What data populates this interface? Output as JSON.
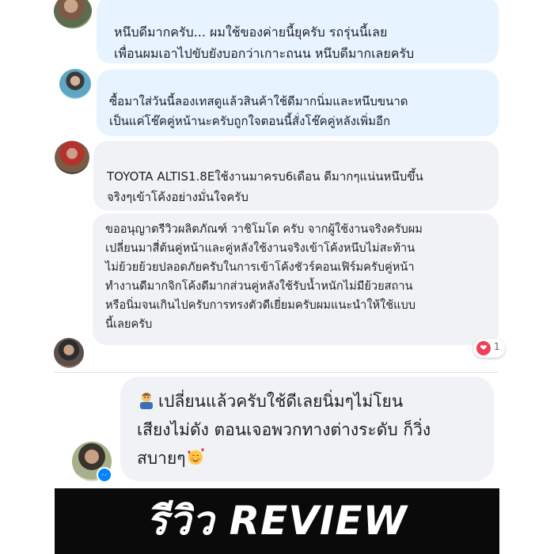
{
  "comments": [
    {
      "lines": [
        "หนึบดีมากครับ... ผมใช้ของค่ายนี้ยุครับ รถรุ่นนี้เลย",
        "เพื่อนผมเอาไปขับยังบอกว่าเกาะถนน หนึบดีมากเลยครับ"
      ]
    },
    {
      "lines": [
        "ซื้อมาใส่วันนี้ลองเทสดูแล้วสินค้าใช้ดีมากนิ่มและหนึบขนาด",
        "เป็นแค่โช๊คคู่หน้านะครับถูกใจตอนนี้สั่งโช๊คคู่หลังเพิ่มอีก"
      ]
    },
    {
      "lines": [
        "TOYOTA ALTIS1.8Eใช้งานมาครบ6เดือน ดีมากๆแน่นหนึบขึ้น",
        "จริงๆเข้าโค้งอย่างมั่นใจครับ"
      ]
    },
    {
      "lines": [
        "ขออนุญาตรีวิวผลิตภัณฑ์ วาชิโมโต ครับ จากผู้ใช้งานจริงครับผม",
        "เปลี่ยนมาสี่ต้นคู่หน้าและคู่หลังใช้งานจริงเข้าโค้งหนึบไม่สะท้าน",
        "ไม่ย้วยย้วยปลอดภัยครับในการเข้าโค้งชัวร์คอนเฟิร์มครับคู่หน้า",
        "ทำงานดีมากจิกโค้งดีมากส่วนคู่หลังใช้รับน้ำหนักไม่มีย้วยสถาน",
        "หรือนิ่มจนเกินไปครับการทรงตัวดีเยี่ยมครับผมแนะนำให้ใช้แบบ",
        "นี้เลยครับ"
      ],
      "reaction": {
        "icon": "heart-icon",
        "count": "1"
      }
    }
  ],
  "messenger": {
    "lines": [
      "เปลี่ยนแล้วครับใช้ดีเลยนิ่มๆไม่โยน",
      "เสียงไม่ดัง ตอนเจอพวกทางต่างระดับ ก็วิ่ง",
      "สบายๆ"
    ],
    "leading_emoji": "mechanic-emoji",
    "trailing_emoji": "smiling-face-with-hearts-emoji",
    "badge_icon": "messenger-icon"
  },
  "banner": {
    "text": "รีวิว REVIEW"
  },
  "colors": {
    "bubble_blue": "#e7f3ff",
    "bubble_gray": "#f0f2f5",
    "heart": "#f33e58",
    "messenger_blue": "#0084ff",
    "banner_bg": "#0a0a0a"
  }
}
